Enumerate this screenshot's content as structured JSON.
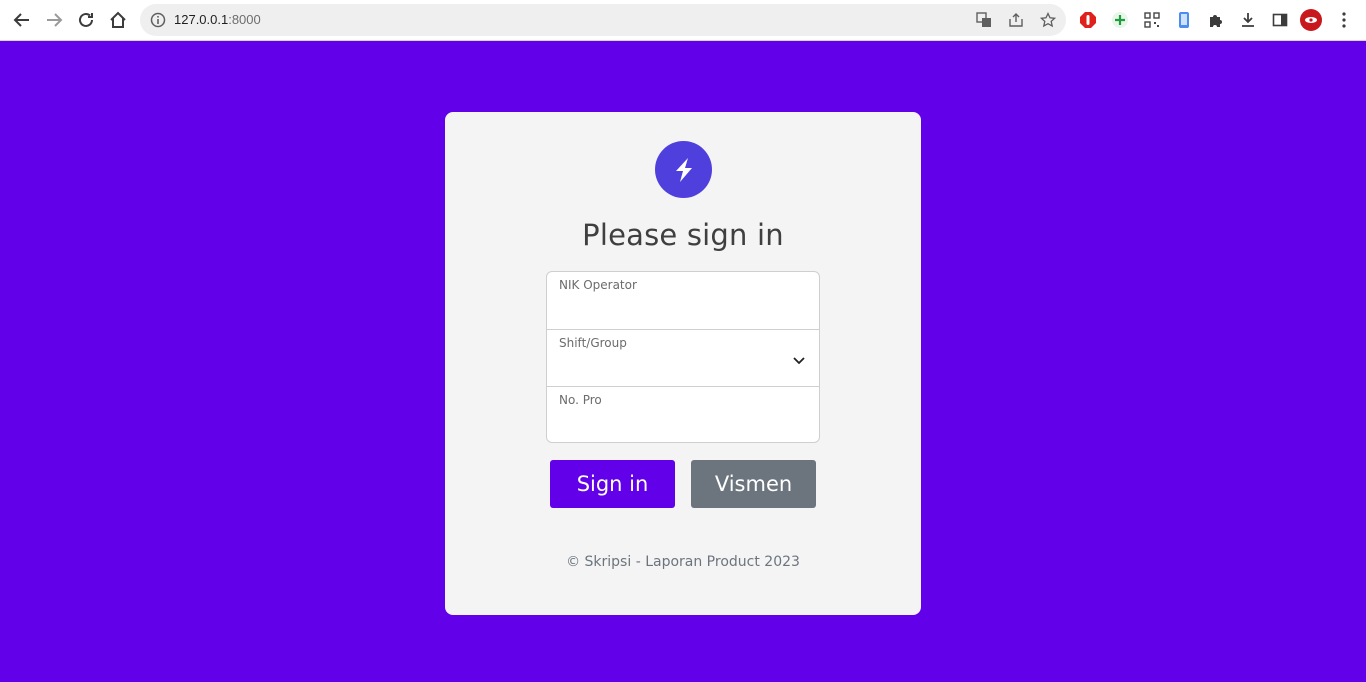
{
  "browser": {
    "url_host": "127.0.0.1",
    "url_port": ":8000"
  },
  "login": {
    "title": "Please sign in",
    "fields": [
      {
        "label": "NIK Operator",
        "value": ""
      },
      {
        "label": "Shift/Group",
        "value": ""
      },
      {
        "label": "No. Pro",
        "value": ""
      }
    ],
    "signin_label": "Sign in",
    "vismen_label": "Vismen",
    "footer": "© Skripsi - Laporan Product 2023"
  },
  "colors": {
    "page_bg": "#6200ea",
    "card_bg": "#f4f4f4",
    "primary": "#6200ea",
    "secondary": "#6c757d",
    "logo": "#4f3fdc"
  }
}
